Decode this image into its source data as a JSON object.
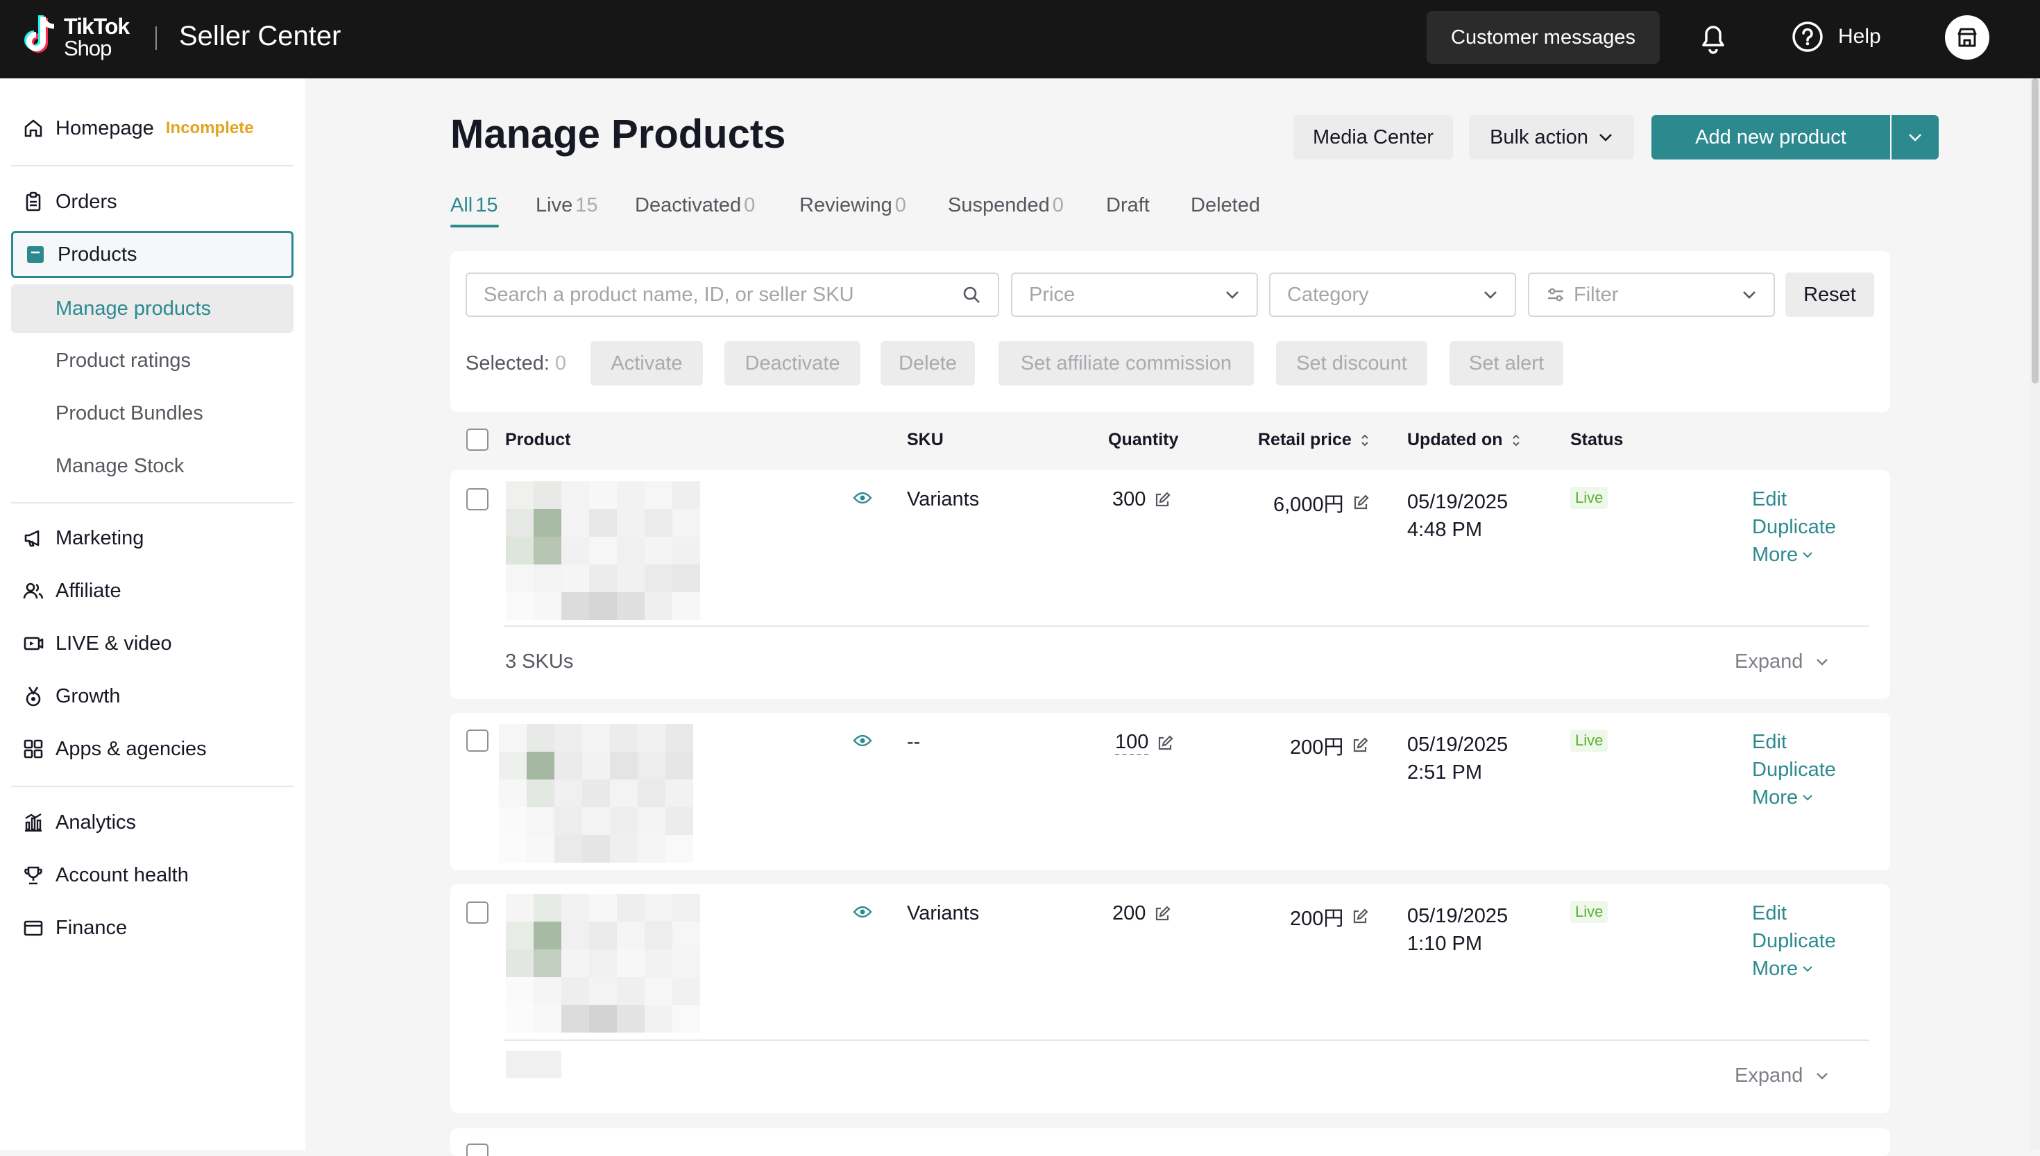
{
  "colors": {
    "accent": "#2c8a8f",
    "warning": "#e4a321",
    "live_text": "#5cb133",
    "live_bg": "#eef8ea",
    "topbar": "#161616"
  },
  "topbar": {
    "brand_line1": "TikTok",
    "brand_line2": "Shop",
    "title": "Seller Center",
    "customer_messages": "Customer messages",
    "help": "Help",
    "icons": [
      "tiktok-logo-icon",
      "bell-icon",
      "help-circle-icon",
      "store-icon"
    ]
  },
  "sidebar": {
    "homepage": "Homepage",
    "homepage_badge": "Incomplete",
    "orders": "Orders",
    "products": "Products",
    "products_sub": [
      "Manage products",
      "Product ratings",
      "Product Bundles",
      "Manage Stock"
    ],
    "marketing": "Marketing",
    "affiliate": "Affiliate",
    "live_video": "LIVE & video",
    "growth": "Growth",
    "apps": "Apps & agencies",
    "analytics": "Analytics",
    "account_health": "Account health",
    "finance": "Finance"
  },
  "header": {
    "title": "Manage Products",
    "media_center": "Media Center",
    "bulk_action": "Bulk action",
    "add_new": "Add new product"
  },
  "tabs": [
    {
      "label": "All",
      "count": "15"
    },
    {
      "label": "Live",
      "count": "15"
    },
    {
      "label": "Deactivated",
      "count": "0"
    },
    {
      "label": "Reviewing",
      "count": "0"
    },
    {
      "label": "Suspended",
      "count": "0"
    },
    {
      "label": "Draft",
      "count": ""
    },
    {
      "label": "Deleted",
      "count": ""
    }
  ],
  "filters": {
    "search_placeholder": "Search a product name, ID, or seller SKU",
    "price": "Price",
    "category": "Category",
    "filter": "Filter",
    "reset": "Reset"
  },
  "bulk": {
    "selected_label": "Selected:",
    "selected_count": "0",
    "actions": [
      "Activate",
      "Deactivate",
      "Delete",
      "Set affiliate commission",
      "Set discount",
      "Set alert"
    ]
  },
  "table": {
    "columns": [
      "Product",
      "SKU",
      "Quantity",
      "Retail price",
      "Updated on",
      "Status"
    ],
    "rows": [
      {
        "sku": "Variants",
        "quantity": "300",
        "price": "6,000円",
        "date": "05/19/2025",
        "time": "4:48 PM",
        "status": "Live",
        "actions": [
          "Edit",
          "Duplicate",
          "More"
        ],
        "skus_label": "3 SKUs",
        "expand": "Expand"
      },
      {
        "sku": "--",
        "quantity": "100",
        "price": "200円",
        "date": "05/19/2025",
        "time": "2:51 PM",
        "status": "Live",
        "actions": [
          "Edit",
          "Duplicate",
          "More"
        ]
      },
      {
        "sku": "Variants",
        "quantity": "200",
        "price": "200円",
        "date": "05/19/2025",
        "time": "1:10 PM",
        "status": "Live",
        "actions": [
          "Edit",
          "Duplicate",
          "More"
        ],
        "expand": "Expand"
      }
    ]
  }
}
